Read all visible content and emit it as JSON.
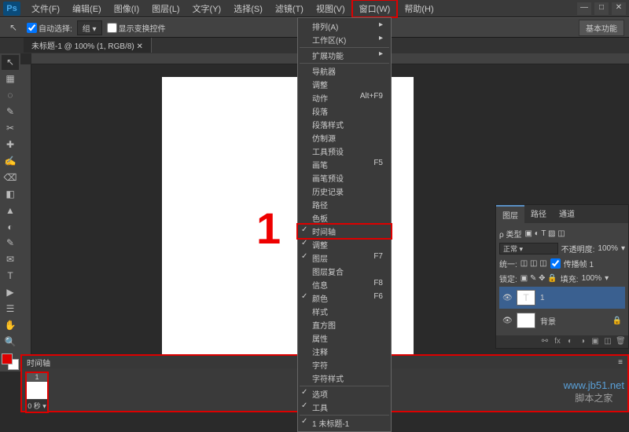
{
  "menubar": {
    "logo": "Ps",
    "items": [
      "文件(F)",
      "编辑(E)",
      "图像(I)",
      "图层(L)",
      "文字(Y)",
      "选择(S)",
      "滤镜(T)",
      "视图(V)",
      "窗口(W)",
      "帮助(H)"
    ],
    "highlight_index": 8
  },
  "options": {
    "auto_select_label": "自动选择:",
    "auto_select_value": "组",
    "transform_label": "显示变换控件",
    "right_btn": "基本功能"
  },
  "doc_tab": "未标题-1 @ 100% (1, RGB/8)",
  "canvas_text": "1",
  "dropdown": {
    "groups": [
      [
        {
          "label": "排列(A)",
          "arrow": true
        },
        {
          "label": "工作区(K)",
          "arrow": true
        }
      ],
      [
        {
          "label": "扩展功能",
          "arrow": true
        }
      ],
      [
        {
          "label": "导航器"
        },
        {
          "label": "调整"
        },
        {
          "label": "动作",
          "shortcut": "Alt+F9"
        },
        {
          "label": "段落"
        },
        {
          "label": "段落样式"
        },
        {
          "label": "仿制源"
        },
        {
          "label": "工具预设"
        },
        {
          "label": "画笔",
          "shortcut": "F5"
        },
        {
          "label": "画笔预设"
        },
        {
          "label": "历史记录"
        },
        {
          "label": "路径"
        },
        {
          "label": "色板"
        },
        {
          "label": "时间轴",
          "checked": true,
          "hl": true
        },
        {
          "label": "调整",
          "checked": true
        },
        {
          "label": "图层",
          "shortcut": "F7",
          "checked": true
        },
        {
          "label": "图层复合"
        },
        {
          "label": "信息",
          "shortcut": "F8"
        },
        {
          "label": "颜色",
          "shortcut": "F6",
          "checked": true
        },
        {
          "label": "样式"
        },
        {
          "label": "直方图"
        },
        {
          "label": "属性"
        },
        {
          "label": "注释"
        },
        {
          "label": "字符"
        },
        {
          "label": "字符样式"
        }
      ],
      [
        {
          "label": "选项",
          "checked": true
        },
        {
          "label": "工具",
          "checked": true
        }
      ],
      [
        {
          "label": "1 未标题-1",
          "checked": true
        }
      ]
    ]
  },
  "panels": {
    "tabs": [
      "图层",
      "路径",
      "通道"
    ],
    "active_tab": 0,
    "kind_label": "ρ 类型",
    "blend_mode": "正常",
    "opacity_label": "不透明度:",
    "opacity_value": "100%",
    "unify_label": "统一:",
    "propagate_label": "传播帧 1",
    "lock_label": "锁定:",
    "fill_label": "填充:",
    "fill_value": "100%",
    "layers": [
      {
        "name": "1",
        "kind": "T"
      },
      {
        "name": "背景",
        "locked": true
      }
    ]
  },
  "timeline": {
    "title": "时间轴",
    "frame_num": "1",
    "duration": "0 秒"
  },
  "tools": [
    "↖",
    "▦",
    "◌",
    "✎",
    "✂",
    "✚",
    "✍",
    "⌫",
    "◧",
    "▲",
    "◐",
    "✎",
    "✉",
    "T",
    "▶",
    "☰",
    "✋",
    "🔍"
  ],
  "watermark": {
    "url": "www.jb51.net",
    "name": "脚本之家"
  }
}
